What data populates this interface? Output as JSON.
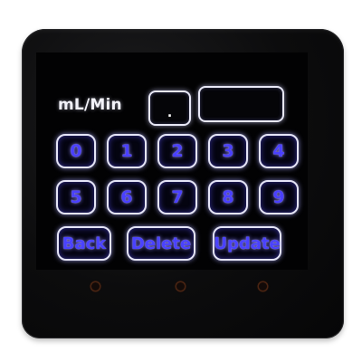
{
  "display": {
    "unit_label": "mL/Min",
    "small_field_value": ".",
    "wide_field_value": ""
  },
  "keypad": {
    "row1": [
      "0",
      "1",
      "2",
      "3",
      "4"
    ],
    "row2": [
      "5",
      "6",
      "7",
      "8",
      "9"
    ],
    "back_label": "Back",
    "delete_label": "Delete",
    "update_label": "Update"
  },
  "colors": {
    "key_text": "#4a40ff",
    "key_border": "#e4e4f6",
    "bezel": "#0c0c0d"
  }
}
